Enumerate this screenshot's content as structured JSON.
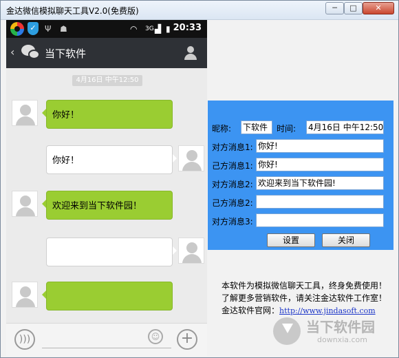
{
  "window": {
    "title": "金达微信模拟聊天工具V2.0(免费版)",
    "min_glyph": "─",
    "max_glyph": "□",
    "close_glyph": "✕"
  },
  "phone": {
    "status_time": "20:33",
    "status_network": "3G",
    "nav_title": "当下软件",
    "timestamp": "4月16日 中午12:50",
    "messages": [
      {
        "side": "left",
        "text": "你好！"
      },
      {
        "side": "right",
        "text": "你好！"
      },
      {
        "side": "left",
        "text": "欢迎来到当下软件园！"
      },
      {
        "side": "right",
        "text": ""
      },
      {
        "side": "left",
        "text": ""
      }
    ]
  },
  "panel": {
    "nickname_label": "昵称:",
    "nickname_value": "下软件",
    "time_label": "时间:",
    "time_value": "4月16日 中午12:50",
    "rows": [
      {
        "label": "对方消息1:",
        "value": "你好!"
      },
      {
        "label": "己方消息1:",
        "value": "你好!"
      },
      {
        "label": "对方消息2:",
        "value": "欢迎来到当下软件园!"
      },
      {
        "label": "己方消息2:",
        "value": ""
      },
      {
        "label": "对方消息3:",
        "value": ""
      }
    ],
    "set_button": "设置",
    "close_button": "关闭"
  },
  "info": {
    "line1": "本软件为模拟微信聊天工具，终身免费使用！",
    "line2": "了解更多营销软件，请关注金达软件工作室！",
    "site_label": "金达软件官网：",
    "site_url": "http://www.jindasoft.com"
  },
  "watermark": {
    "name": "当下软件园",
    "domain": "downxia.com"
  }
}
